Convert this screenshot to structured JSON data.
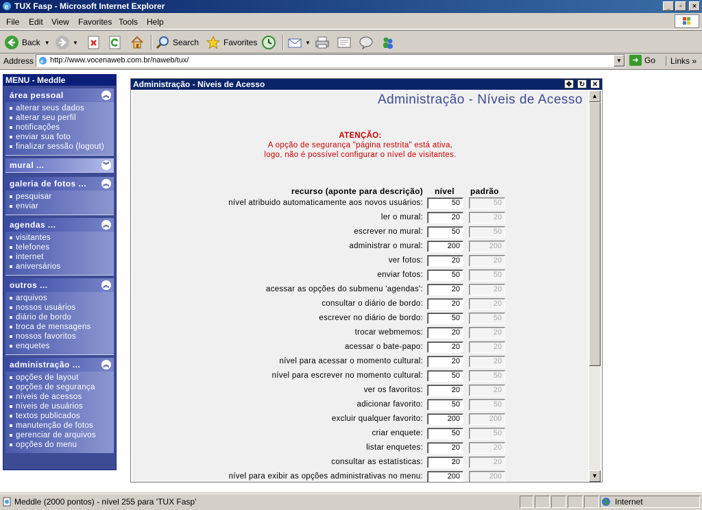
{
  "window": {
    "title": "TUX Fasp - Microsoft Internet Explorer"
  },
  "menubar": [
    "File",
    "Edit",
    "View",
    "Favorites",
    "Tools",
    "Help"
  ],
  "toolbar": {
    "back": "Back",
    "search": "Search",
    "favorites": "Favorites"
  },
  "address": {
    "label": "Address",
    "url": "http://www.vocenaweb.com.br/naweb/tux/",
    "go": "Go",
    "links": "Links"
  },
  "sidebar": {
    "header": "MENU - Meddle",
    "sections": [
      {
        "title": "área pessoal",
        "items": [
          "alterar seus dados",
          "alterar seu perfil",
          "notificações",
          "enviar sua foto",
          "finalizar sessão (logout)"
        ]
      },
      {
        "title": "mural ...",
        "items": []
      },
      {
        "title": "galeria de fotos ...",
        "items": [
          "pesquisar",
          "enviar"
        ]
      },
      {
        "title": "agendas ...",
        "items": [
          "visitantes",
          "telefones",
          "internet",
          "aniversários"
        ]
      },
      {
        "title": "outros ...",
        "items": [
          "arquivos",
          "nossos usuários",
          "diário de bordo",
          "troca de mensagens",
          "nossos favoritos",
          "enquetes"
        ]
      },
      {
        "title": "administração ...",
        "items": [
          "opções de layout",
          "opções de segurança",
          "níveis de acessos",
          "níveis de usuários",
          "textos publicados",
          "manutenção de fotos",
          "gerenciar de arquivos",
          "opções do menu"
        ]
      }
    ]
  },
  "admin": {
    "window_title": "Administração - Níveis de Acesso",
    "page_title": "Administração - Níveis de Acesso",
    "warning_title": "ATENÇÃO:",
    "warning_line1": "A opção de segurança \"página restrita\" está ativa,",
    "warning_line2": "logo, não é possível configurar o nível de visitantes.",
    "col_resource": "recurso (aponte para descrição)",
    "col_level": "nível",
    "col_default": "padrão",
    "rows": [
      {
        "label": "nível atribuido automaticamente aos novos usuários:",
        "level": "50",
        "default": "50"
      },
      {
        "label": "ler o mural:",
        "level": "20",
        "default": "20"
      },
      {
        "label": "escrever no mural:",
        "level": "50",
        "default": "50"
      },
      {
        "label": "administrar o mural:",
        "level": "200",
        "default": "200"
      },
      {
        "label": "ver fotos:",
        "level": "20",
        "default": "20"
      },
      {
        "label": "enviar fotos:",
        "level": "50",
        "default": "50"
      },
      {
        "label": "acessar as opções do submenu 'agendas':",
        "level": "20",
        "default": "20"
      },
      {
        "label": "consultar o diário de bordo:",
        "level": "20",
        "default": "20"
      },
      {
        "label": "escrever no diário de bordo:",
        "level": "50",
        "default": "50"
      },
      {
        "label": "trocar webmemos:",
        "level": "20",
        "default": "20"
      },
      {
        "label": "acessar o bate-papo:",
        "level": "20",
        "default": "20"
      },
      {
        "label": "nível para acessar o momento cultural:",
        "level": "20",
        "default": "20"
      },
      {
        "label": "nível para escrever no momento cultural:",
        "level": "50",
        "default": "50"
      },
      {
        "label": "ver os favoritos:",
        "level": "20",
        "default": "20"
      },
      {
        "label": "adicionar favorito:",
        "level": "50",
        "default": "50"
      },
      {
        "label": "excluir qualquer favorito:",
        "level": "200",
        "default": "200"
      },
      {
        "label": "criar enquete:",
        "level": "50",
        "default": "50"
      },
      {
        "label": "listar enquetes:",
        "level": "20",
        "default": "20"
      },
      {
        "label": "consultar as estatísticas:",
        "level": "20",
        "default": "20"
      },
      {
        "label": "nível para exibir as opções administrativas no menu:",
        "level": "200",
        "default": "200"
      }
    ]
  },
  "status": {
    "text": "Meddle (2000 pontos) - nível 255 para 'TUX Fasp'",
    "zone": "Internet"
  }
}
